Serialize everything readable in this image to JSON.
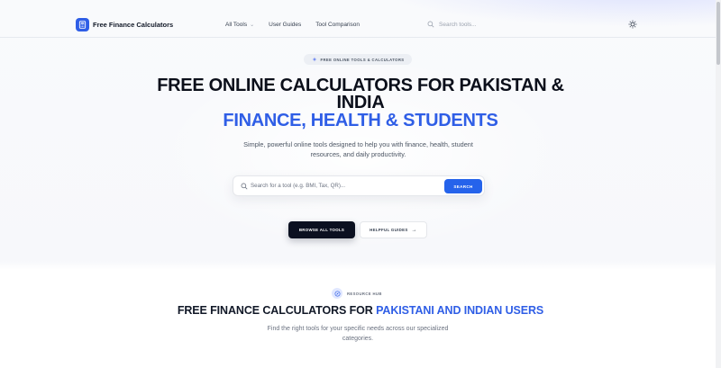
{
  "app": {
    "title": "Free Finance Calculators"
  },
  "nav": {
    "items": [
      {
        "label": "All Tools",
        "has_dropdown": true
      },
      {
        "label": "User Guides"
      },
      {
        "label": "Tool Comparison"
      }
    ],
    "search_placeholder": "Search tools..."
  },
  "hero": {
    "badge": "FREE ONLINE TOOLS & CALCULATORS",
    "title": "FREE ONLINE CALCULATORS FOR PAKISTAN & INDIA",
    "subtitle": "FINANCE, HEALTH & STUDENTS",
    "description": "Simple, powerful online tools designed to help you with finance, health, student resources, and daily productivity.",
    "search_placeholder": "Search for a tool (e.g. BMI, Tax, QR)...",
    "search_button": "SEARCH",
    "primary_button": "BROWSE ALL TOOLS",
    "secondary_button": "HELPFUL GUIDES"
  },
  "resources": {
    "badge": "RESOURCE HUB",
    "title_part1": "FREE FINANCE CALCULATORS FOR",
    "title_accent": "PAKISTANI AND INDIAN USERS",
    "description": "Find the right tools for your specific needs across our specialized categories."
  },
  "colors": {
    "accent": "#2f5ee6",
    "primary_button": "#0b1020",
    "search_button": "#2563eb"
  },
  "icons": {
    "logo": "calculator-icon",
    "search": "search-icon",
    "theme": "sun-icon",
    "badge": "sparkle-icon",
    "hub": "compass-icon",
    "arrow": "arrow-right-icon"
  }
}
